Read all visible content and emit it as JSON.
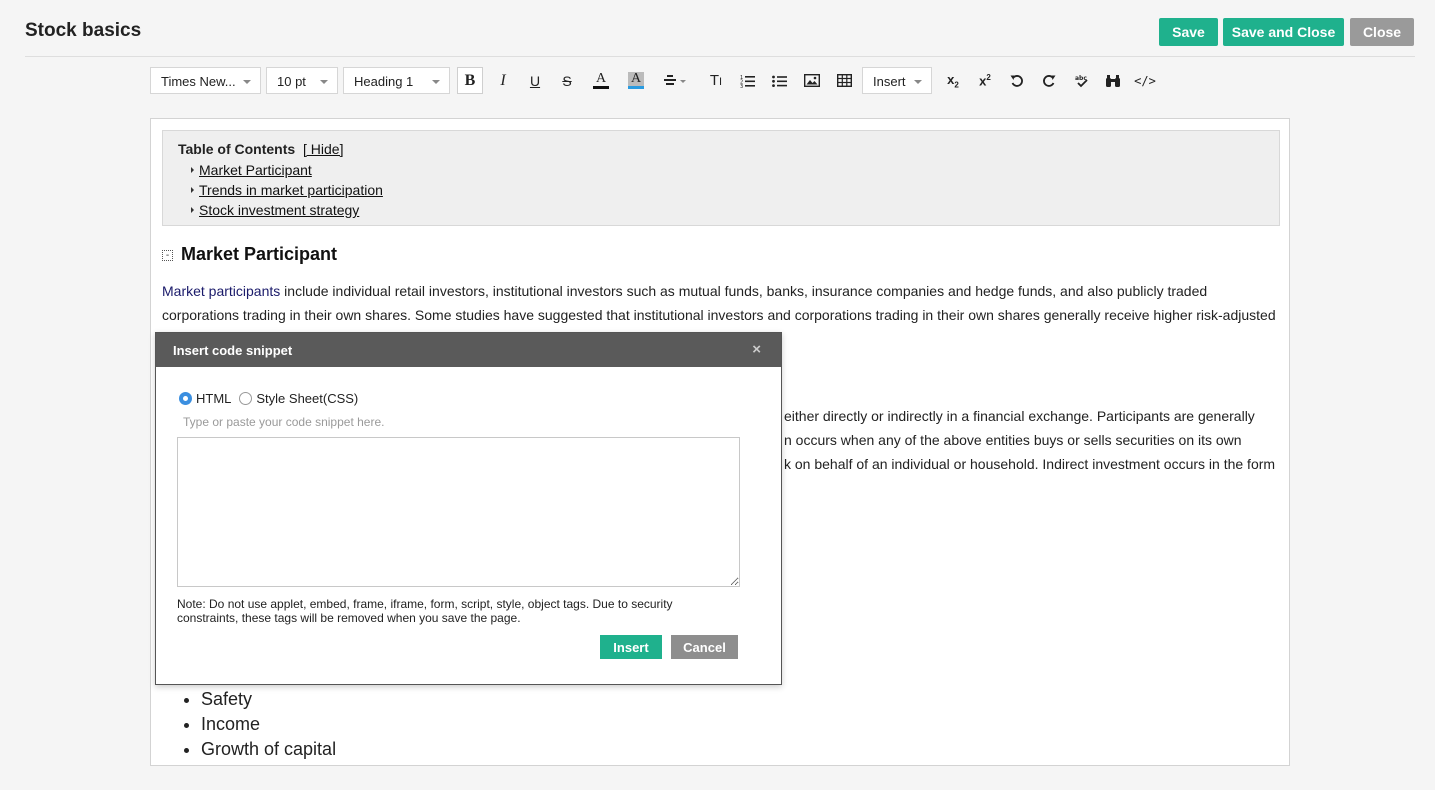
{
  "header": {
    "title": "Stock basics",
    "save_label": "Save",
    "save_close_label": "Save and Close",
    "close_label": "Close"
  },
  "toolbar": {
    "font_family": "Times New...",
    "font_size": "10 pt",
    "block_format": "Heading 1",
    "insert_label": "Insert"
  },
  "toc": {
    "title": "Table of Contents",
    "hide_label": "[ Hide]",
    "items": [
      "Market Participant",
      "Trends in market participation",
      "Stock investment strategy"
    ]
  },
  "content": {
    "heading": "Market Participant",
    "para1_link": "Market participants",
    "para1_line1_rest": " include individual retail investors, institutional investors such as mutual funds, banks, insurance companies and hedge funds, and also publicly traded",
    "para1_line2": "corporations trading in their own shares. Some studies have suggested that institutional investors and corporations trading in their own shares generally receive higher risk-adjusted",
    "para2_line1": "either directly or indirectly in a financial exchange. Participants are generally",
    "para2_line2": "n occurs when any of the above entities buys or sells securities on its own",
    "para2_line3": "k on behalf of an individual or household. Indirect investment occurs in the form",
    "list": [
      "Safety",
      "Income",
      "Growth of capital"
    ]
  },
  "modal": {
    "title": "Insert code snippet",
    "close_glyph": "×",
    "radio_html": "HTML",
    "radio_css": "Style Sheet(CSS)",
    "hint": "Type or paste your code snippet here.",
    "note": "Note: Do not use applet, embed, frame, iframe, form, script, style, object tags. Due to security constraints, these tags will be removed when you save the page.",
    "insert_label": "Insert",
    "cancel_label": "Cancel"
  },
  "colors": {
    "accent": "#1fb18d",
    "neutral_button": "#9a9a9a",
    "modal_header": "#5a5a5a"
  }
}
